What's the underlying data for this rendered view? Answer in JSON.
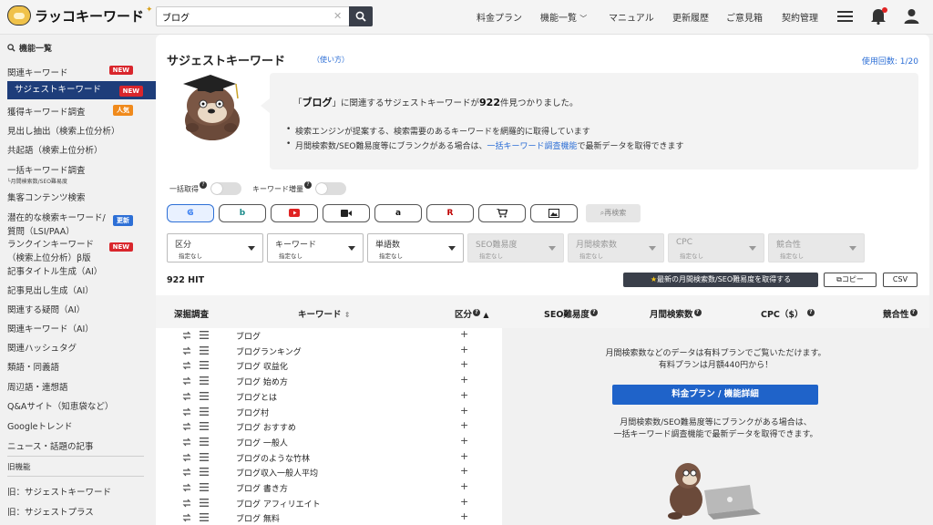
{
  "app": {
    "logo_text": "ラッコキーワード"
  },
  "search": {
    "value": "ブログ",
    "placeholder": ""
  },
  "nav": {
    "pricing": "料金プラン",
    "features": "機能一覧",
    "manual": "マニュアル",
    "changelog": "更新履歴",
    "feedback": "ご意見箱",
    "contract": "契約管理"
  },
  "sidebar": {
    "heading": "機能一覧",
    "items": [
      {
        "label": "関連キーワード",
        "badge": "NEW"
      },
      {
        "label": "サジェストキーワード",
        "badge": "NEW"
      },
      {
        "label": "獲得キーワード調査",
        "badge": "人気"
      },
      {
        "label": "見出し抽出（検索上位分析）"
      },
      {
        "label": "共起語（検索上位分析）"
      },
      {
        "label": "一括キーワード調査",
        "sub": "└月間検索数/SEO難易度"
      },
      {
        "label": "集客コンテンツ検索"
      },
      {
        "label": "潜在的な検索キーワード/",
        "label2": "質問（LSI/PAA）",
        "badge": "更新"
      },
      {
        "label": "ランクインキーワード",
        "label2": "（検索上位分析）β版",
        "badge": "NEW"
      },
      {
        "label": "記事タイトル生成（AI）"
      },
      {
        "label": "記事見出し生成（AI）"
      },
      {
        "label": "関連する疑問（AI）"
      },
      {
        "label": "関連キーワード（AI）"
      },
      {
        "label": "関連ハッシュタグ"
      },
      {
        "label": "類語・同義語"
      },
      {
        "label": "周辺語・連想語"
      },
      {
        "label": "Q&Aサイト（知恵袋など）"
      },
      {
        "label": "Googleトレンド"
      },
      {
        "label": "ニュース・話題の記事"
      }
    ],
    "old_heading": "旧機能",
    "old_items": [
      {
        "label": "旧：サジェストキーワード"
      },
      {
        "label": "旧：サジェストプラス"
      }
    ]
  },
  "main": {
    "title": "サジェストキーワード",
    "howto": "（使い方）",
    "usage": "使用回数: 1/20",
    "lead_pre": "「",
    "lead_kw": "ブログ",
    "lead_mid": "」に関連するサジェストキーワードが",
    "lead_count": "922",
    "lead_post": "件見つかりました。",
    "bullet1": "検索エンジンが提案する、検索需要のあるキーワードを網羅的に取得しています",
    "bullet2_pre": "月間検索数/SEO難易度等にブランクがある場合は、",
    "bullet2_link": "一括キーワード調査機能",
    "bullet2_post": "で最新データを取得できます",
    "toggle_bulk": "一括取得",
    "toggle_increase": "キーワード増量",
    "rescan": "再検索",
    "filters": [
      {
        "label": "区分",
        "value": "指定なし"
      },
      {
        "label": "キーワード",
        "value": "指定なし"
      },
      {
        "label": "単語数",
        "value": "指定なし"
      },
      {
        "label": "SEO難易度",
        "value": "指定なし"
      },
      {
        "label": "月間検索数",
        "value": "指定なし"
      },
      {
        "label": "CPC",
        "value": "指定なし"
      },
      {
        "label": "競合性",
        "value": "指定なし"
      }
    ],
    "hit": "922 HIT",
    "get_latest": "最新の月間検索数/SEO難易度を取得する",
    "copy": "コピー",
    "csv": "CSV",
    "columns": {
      "dig": "深掘調査",
      "keyword": "キーワード",
      "category": "区分",
      "seo": "SEO難易度",
      "volume": "月間検索数",
      "cpc": "CPC（$）",
      "competition": "競合性"
    },
    "keywords": [
      "ブログ",
      "ブログランキング",
      "ブログ 収益化",
      "ブログ 始め方",
      "ブログとは",
      "ブログ村",
      "ブログ おすすめ",
      "ブログ 一般人",
      "ブログのような竹林",
      "ブログ収入一般人平均",
      "ブログ 書き方",
      "ブログ アフィリエイト",
      "ブログ 無料"
    ],
    "upsell_line1": "月間検索数などのデータは有料プランでご覧いただけます。",
    "upsell_line2": "有料プランは月額440円から！",
    "plan_button": "料金プラン / 機能詳細",
    "upsell_line3": "月間検索数/SEO難易度等にブランクがある場合は、",
    "upsell_line4": "一括キーワード調査機能で最新データを取得できます。"
  },
  "colors": {
    "active_nav": "#1e3d7a",
    "badge_new": "#d9262c",
    "accent": "#2d6fd6",
    "plan_button": "#1f63c9"
  },
  "icons": [
    "search-icon",
    "hamburger-icon",
    "bell-icon",
    "user-icon",
    "google-icon",
    "bing-icon",
    "youtube-icon",
    "video-icon",
    "amazon-icon",
    "rakuten-icon",
    "cart-icon",
    "image-icon"
  ]
}
